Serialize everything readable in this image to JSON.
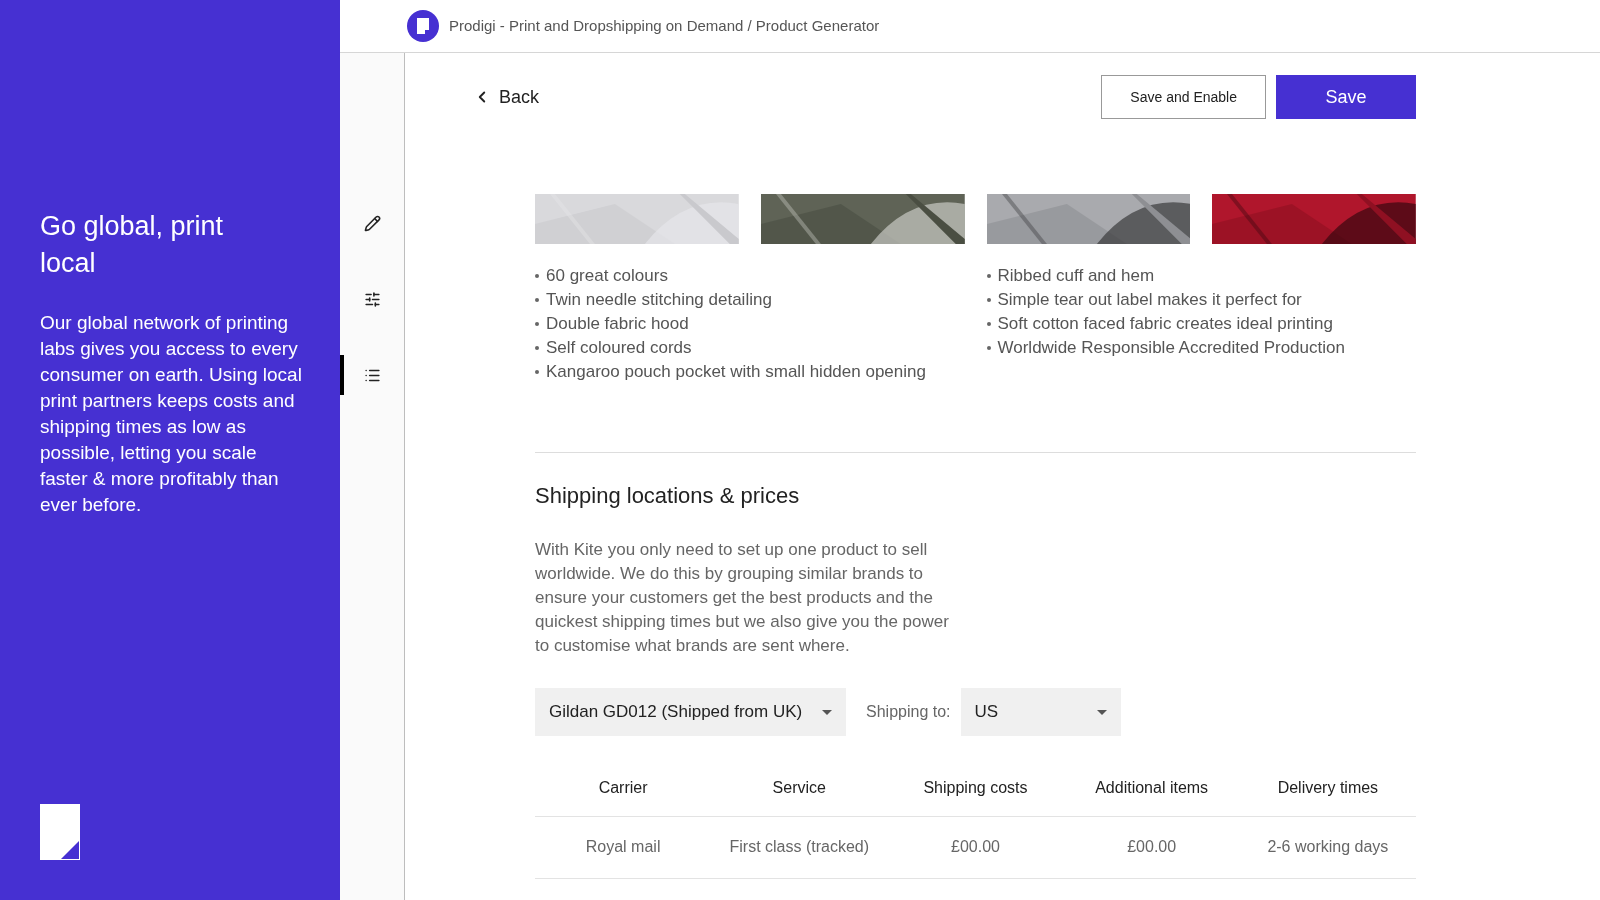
{
  "promo": {
    "title": "Go global, print local",
    "body": "Our global network of printing labs gives you access to every consumer on earth. Using local print partners keeps costs and shipping times as low as possible, letting you scale faster & more profitably than ever before."
  },
  "header": {
    "title": "Prodigi - Print and Dropshipping on Demand / Product Generator"
  },
  "rail": [
    {
      "kind": "pencil",
      "selected": false
    },
    {
      "kind": "sliders",
      "selected": false
    },
    {
      "kind": "list",
      "selected": true
    }
  ],
  "toolbar": {
    "back": "Back",
    "save_enable": "Save and Enable",
    "save": "Save"
  },
  "swatches": [
    {
      "kind": "picture"
    },
    {
      "kind": "picture"
    },
    {
      "kind": "picture"
    },
    {
      "kind": "picture"
    }
  ],
  "features_left": [
    "60 great colours",
    "Twin needle stitching detailing",
    "Double fabric hood",
    "Self coloured cords",
    "Kangaroo pouch pocket with small hidden opening"
  ],
  "features_right": [
    "Ribbed cuff and hem",
    "Simple tear out label makes it perfect for",
    "Soft cotton faced fabric creates ideal printing",
    "Worldwide Responsible Accredited Production"
  ],
  "shipping": {
    "title": "Shipping locations & prices",
    "body": "With Kite you only need to set up one product to sell worldwide. We do this by grouping similar brands to ensure your customers get the best products and the quickest shipping times but we also give you the power to customise what brands are sent where.",
    "brand": "Gildan GD012 (Shipped from UK)",
    "shipping_to_label": "Shipping to:",
    "country": "US"
  },
  "table": {
    "columns": [
      "Carrier",
      "Service",
      "Shipping costs",
      "Additional items",
      "Delivery times"
    ],
    "rows": [
      [
        "Royal mail",
        "First class (tracked)",
        "£00.00",
        "£00.00",
        "2-6 working days"
      ]
    ]
  }
}
